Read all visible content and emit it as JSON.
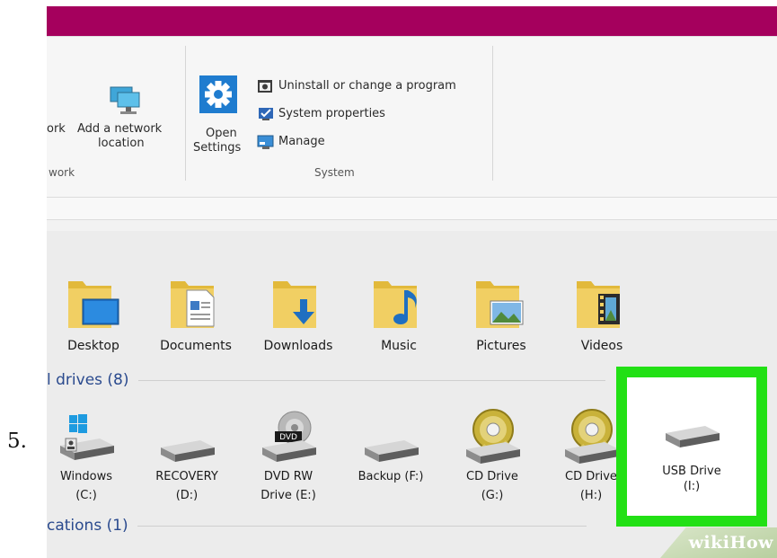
{
  "step_number": "5.",
  "ribbon": {
    "network_fragment": "ork",
    "add_network_location": [
      "Add a network",
      "location"
    ],
    "network_group_label": "work",
    "open_settings": [
      "Open",
      "Settings"
    ],
    "uninstall": "Uninstall or change a program",
    "system_properties": "System properties",
    "manage": "Manage",
    "system_group_label": "System"
  },
  "folders": [
    {
      "label": "Desktop",
      "icon": "desktop-folder-icon"
    },
    {
      "label": "Documents",
      "icon": "documents-folder-icon"
    },
    {
      "label": "Downloads",
      "icon": "downloads-folder-icon"
    },
    {
      "label": "Music",
      "icon": "music-folder-icon"
    },
    {
      "label": "Pictures",
      "icon": "pictures-folder-icon"
    },
    {
      "label": "Videos",
      "icon": "videos-folder-icon"
    }
  ],
  "drives_header": "l drives (8)",
  "drives": [
    {
      "name": "Windows",
      "letter": "(C:)",
      "icon": "windows-drive-icon"
    },
    {
      "name": "RECOVERY",
      "letter": "(D:)",
      "icon": "hard-drive-icon"
    },
    {
      "name": "DVD RW",
      "letter": "Drive (E:)",
      "icon": "dvd-drive-icon"
    },
    {
      "name": "Backup (F:)",
      "letter": "",
      "icon": "hard-drive-icon"
    },
    {
      "name": "CD Drive",
      "letter": "(G:)",
      "icon": "cd-drive-icon"
    },
    {
      "name": "CD Drive",
      "letter": "(H:)",
      "icon": "cd-drive-icon"
    },
    {
      "name": "USB Drive",
      "letter": "(I:)",
      "icon": "usb-drive-icon"
    }
  ],
  "locations_header": "cations (1)",
  "highlight_color": "#22e015",
  "titlebar_color": "#a5005d",
  "watermark": "wikiHow"
}
